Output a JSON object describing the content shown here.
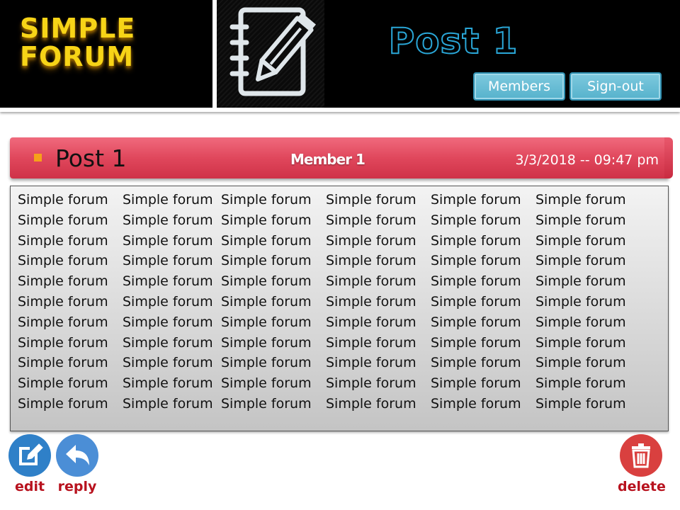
{
  "header": {
    "logo_line1": "SIMPLE",
    "logo_line2": "FORUM",
    "page_title": "Post 1",
    "members_label": "Members",
    "signout_label": "Sign-out",
    "accent_color": "#2aa7d8",
    "logo_color": "#f7d417",
    "icon": "notebook-pencil-icon"
  },
  "post": {
    "title": "Post 1",
    "author": "Member 1",
    "datetime": "3/3/2018 -- 09:47 pm",
    "bar_color": "#e0475c",
    "body_lines": [
      [
        "Simple forum",
        "Simple forum",
        "Simple forum",
        "Simple forum",
        "Simple forum",
        "Simple forum"
      ],
      [
        "Simple forum",
        "Simple forum",
        "Simple forum",
        "Simple forum",
        "Simple forum",
        "Simple forum"
      ],
      [
        "Simple forum",
        "Simple forum",
        "Simple forum",
        "Simple forum",
        "Simple forum",
        "Simple forum"
      ],
      [
        "Simple forum",
        "Simple forum",
        "Simple forum",
        "Simple forum",
        "Simple forum",
        "Simple forum"
      ],
      [
        "Simple forum",
        "Simple forum",
        "Simple forum",
        "Simple forum",
        "Simple forum",
        "Simple forum"
      ],
      [
        "Simple forum",
        "Simple forum",
        "Simple forum",
        "Simple forum",
        "Simple forum",
        "Simple forum"
      ],
      [
        "Simple forum",
        "Simple forum",
        "Simple forum",
        "Simple forum",
        "Simple forum",
        "Simple forum"
      ],
      [
        "Simple forum",
        "Simple forum",
        "Simple forum",
        "Simple forum",
        "Simple forum",
        "Simple forum"
      ],
      [
        "Simple forum",
        "Simple forum",
        "Simple forum",
        "Simple forum",
        "Simple forum",
        "Simple forum"
      ],
      [
        "Simple forum",
        "Simple forum",
        "Simple forum",
        "Simple forum",
        "Simple forum",
        "Simple forum"
      ],
      [
        "Simple forum",
        "Simple forum",
        "Simple forum",
        "Simple forum",
        "Simple forum",
        "Simple forum"
      ]
    ]
  },
  "actions": {
    "edit_label": "edit",
    "reply_label": "reply",
    "delete_label": "delete",
    "edit_icon": "edit-icon",
    "reply_icon": "reply-icon",
    "delete_icon": "trash-icon"
  }
}
